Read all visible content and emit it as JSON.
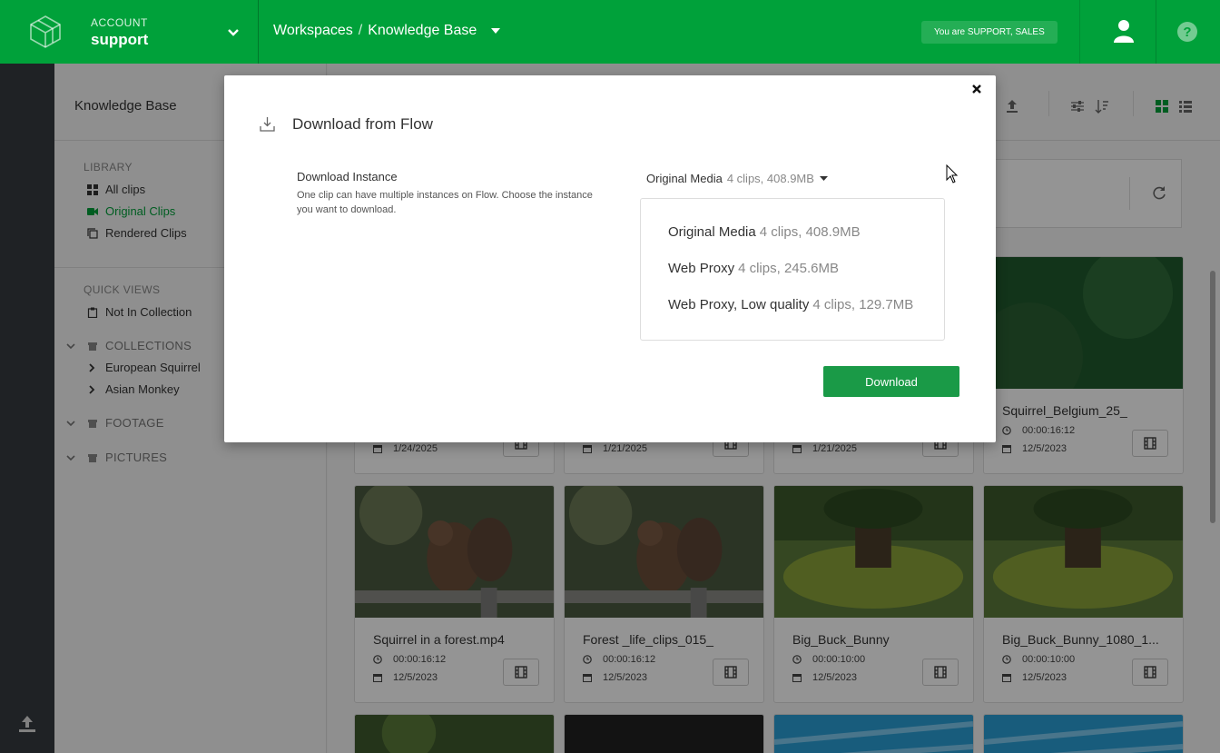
{
  "header": {
    "account_label": "ACCOUNT",
    "account_name": "support",
    "breadcrumb_root": "Workspaces",
    "breadcrumb_sep": "/",
    "breadcrumb_current": "Knowledge Base",
    "role_badge": "You are SUPPORT, SALES"
  },
  "sidebar": {
    "title": "Knowledge Base",
    "library_label": "LIBRARY",
    "library_items": [
      {
        "label": "All clips",
        "icon": "grid-icon"
      },
      {
        "label": "Original Clips",
        "icon": "video-camera-icon"
      },
      {
        "label": "Rendered Clips",
        "icon": "copy-icon"
      }
    ],
    "quickviews_label": "QUICK VIEWS",
    "quickviews_items": [
      {
        "label": "Not In Collection",
        "icon": "clipboard-icon"
      }
    ],
    "collections_label": "COLLECTIONS",
    "collections": [
      "European Squirrel",
      "Asian Monkey"
    ],
    "footage_label": "FOOTAGE",
    "pictures_label": "PICTURES"
  },
  "cards_top": [
    {
      "date": "1/24/2025"
    },
    {
      "date": "1/21/2025"
    },
    {
      "date": "1/21/2025"
    },
    {
      "title": "Squirrel_Belgium_25_",
      "duration": "00:00:16:12",
      "date": "12/5/2023"
    }
  ],
  "cards_mid": [
    {
      "title": "Squirrel in a forest.mp4",
      "duration": "00:00:16:12",
      "date": "12/5/2023"
    },
    {
      "title": "Forest _life_clips_015_",
      "duration": "00:00:16:12",
      "date": "12/5/2023"
    },
    {
      "title": "Big_Buck_Bunny",
      "duration": "00:00:10:00",
      "date": "12/5/2023"
    },
    {
      "title": "Big_Buck_Bunny_1080_1...",
      "duration": "00:00:10:00",
      "date": "12/5/2023"
    }
  ],
  "modal": {
    "title": "Download from Flow",
    "field_label": "Download Instance",
    "field_help": "One clip can have multiple instances on Flow. Choose the instance you want to download.",
    "selected_name": "Original Media",
    "selected_meta": "4 clips, 408.9MB",
    "options": [
      {
        "name": "Original Media",
        "meta": "4 clips, 408.9MB"
      },
      {
        "name": "Web Proxy",
        "meta": "4 clips, 245.6MB"
      },
      {
        "name": "Web Proxy, Low quality",
        "meta": "4 clips, 129.7MB"
      }
    ],
    "download_label": "Download",
    "close_glyph": "×"
  },
  "colors": {
    "brand": "#00a13a",
    "button": "#1a9a47",
    "rail": "#363c40"
  }
}
